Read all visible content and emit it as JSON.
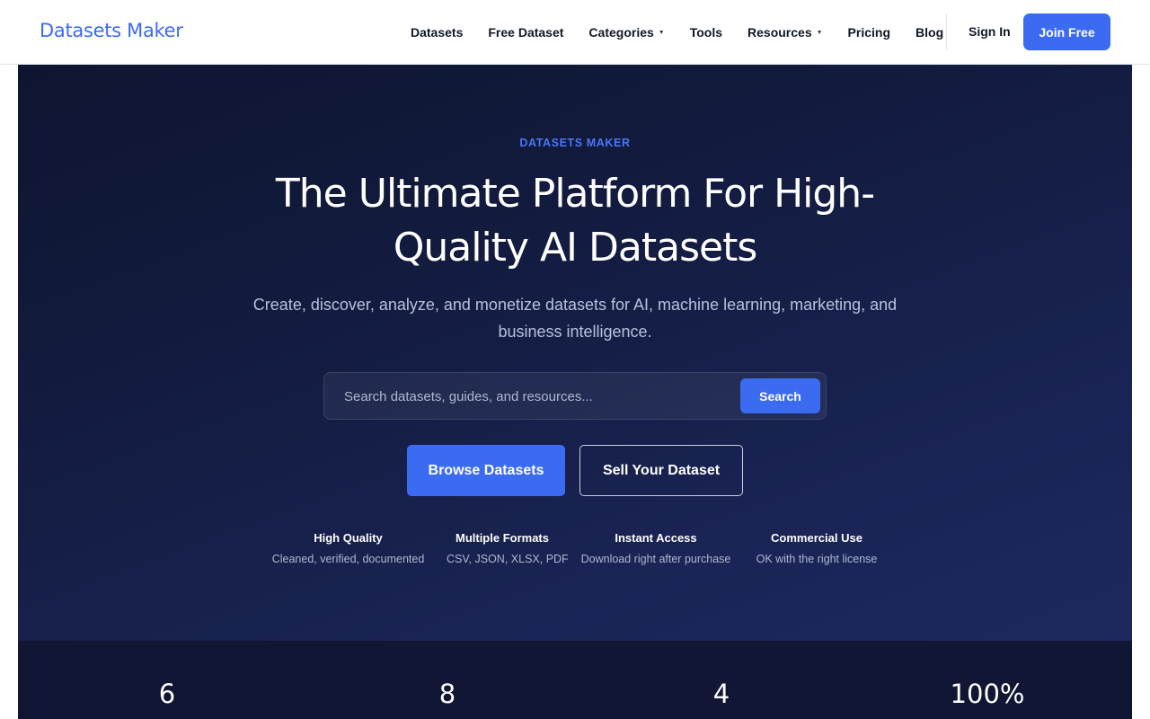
{
  "header": {
    "logo": "Datasets Maker",
    "nav": [
      {
        "label": "Datasets",
        "dropdown": false
      },
      {
        "label": "Free Dataset",
        "dropdown": false
      },
      {
        "label": "Categories",
        "dropdown": true
      },
      {
        "label": "Tools",
        "dropdown": false
      },
      {
        "label": "Resources",
        "dropdown": true
      },
      {
        "label": "Pricing",
        "dropdown": false
      },
      {
        "label": "Blog",
        "dropdown": false
      }
    ],
    "sign_in": "Sign In",
    "join": "Join Free"
  },
  "hero": {
    "eyebrow": "DATASETS MAKER",
    "title": "The Ultimate Platform For High-Quality AI Datasets",
    "subtitle": "Create, discover, analyze, and monetize datasets for AI, machine learning, marketing, and business intelligence.",
    "search": {
      "placeholder": "Search datasets, guides, and resources...",
      "button": "Search"
    },
    "cta_primary": "Browse Datasets",
    "cta_secondary": "Sell Your Dataset",
    "features": [
      {
        "title": "High Quality",
        "desc": "Cleaned, verified, documented"
      },
      {
        "title": "Multiple Formats",
        "desc": "CSV, JSON, XLSX, PDF"
      },
      {
        "title": "Instant Access",
        "desc": "Download right after purchase"
      },
      {
        "title": "Commercial Use",
        "desc": "OK with the right license"
      }
    ]
  },
  "stats": [
    "6",
    "8",
    "4",
    "100%"
  ],
  "colors": {
    "accent": "#3b6bf0",
    "hero_bg": "#141d43",
    "stats_bg": "#101633"
  }
}
